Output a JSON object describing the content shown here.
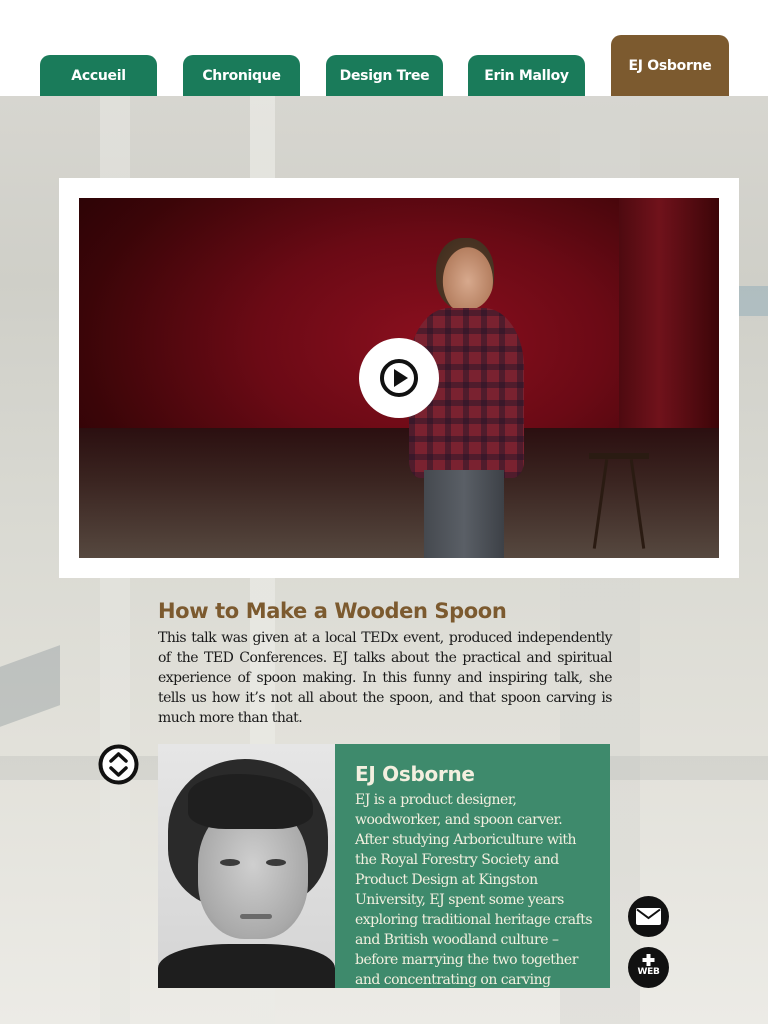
{
  "tabs": [
    {
      "label": "Accueil",
      "active": false
    },
    {
      "label": "Chronique",
      "active": false
    },
    {
      "label": "Design Tree",
      "active": false
    },
    {
      "label": "Erin Malloy",
      "active": false
    },
    {
      "label": "EJ Osborne",
      "active": true
    }
  ],
  "video": {
    "play_icon": "play-circle-icon"
  },
  "talk": {
    "title": "How to Make a Wooden Spoon",
    "description": "This talk was given at a local TEDx event, produced independently of the TED Conferences. EJ talks about the practical and spiritual experience of spoon making. In this funny and inspiring talk, she tells us how it’s not all about the spoon, and that spoon carving is much more than that."
  },
  "bio": {
    "name": "EJ Osborne",
    "text": "EJ is a product designer, woodworker, and spoon carver. After studying Arboriculture with the Royal Forestry Society and Product Design at Kingston University, EJ spent some years exploring traditional heritage crafts and British woodland culture – before marrying the two together and concentrating on carving functional spoons and utensils,"
  },
  "icons": {
    "scroll_toggle": "up-down-chevron-icon",
    "mail": "envelope-icon",
    "web": "plus-web-icon"
  },
  "web_label": "WEB",
  "colors": {
    "tab_green": "#1a7b5a",
    "tab_active_brown": "#7c5a2f",
    "bio_green": "#3e8a6c",
    "title_brown": "#7c5a2f"
  }
}
